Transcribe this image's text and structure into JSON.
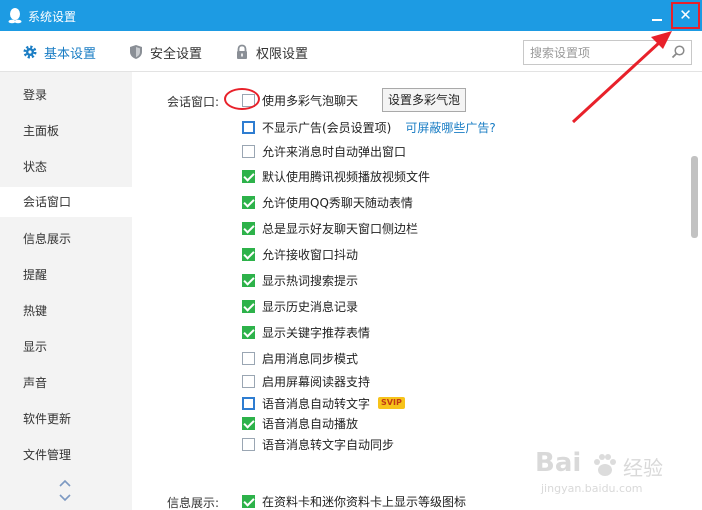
{
  "window": {
    "title": "系统设置"
  },
  "toolbar": {
    "tabs": [
      "基本设置",
      "安全设置",
      "权限设置"
    ],
    "search_placeholder": "搜索设置项"
  },
  "sidebar": {
    "items": [
      "登录",
      "主面板",
      "状态",
      "会话窗口",
      "信息展示",
      "提醒",
      "热键",
      "显示",
      "声音",
      "软件更新",
      "文件管理"
    ]
  },
  "content": {
    "section_chat": "会话窗口:",
    "options": [
      {
        "label": "使用多彩气泡聊天",
        "checked": false
      },
      {
        "label": "不显示广告(会员设置项)",
        "checked": false
      },
      {
        "label": "允许来消息时自动弹出窗口",
        "checked": false
      },
      {
        "label": "默认使用腾讯视频播放视频文件",
        "checked": true
      },
      {
        "label": "允许使用QQ秀聊天随动表情",
        "checked": true
      },
      {
        "label": "总是显示好友聊天窗口侧边栏",
        "checked": true
      },
      {
        "label": "允许接收窗口抖动",
        "checked": true
      },
      {
        "label": "显示热词搜索提示",
        "checked": true
      },
      {
        "label": "显示历史消息记录",
        "checked": true
      },
      {
        "label": "显示关键字推荐表情",
        "checked": true
      },
      {
        "label": "启用消息同步模式",
        "checked": false
      },
      {
        "label": "启用屏幕阅读器支持",
        "checked": false
      },
      {
        "label": "语音消息自动转文字",
        "checked": false
      },
      {
        "label": "语音消息自动播放",
        "checked": true
      },
      {
        "label": "语音消息转文字自动同步",
        "checked": false
      }
    ],
    "setup_bubble_button": "设置多彩气泡",
    "ad_link": "可屏蔽哪些广告?",
    "vip_badge": "SVIP",
    "section_info": "信息展示:",
    "info_option": {
      "label": "在资料卡和迷你资料卡上显示等级图标",
      "checked": true
    }
  },
  "watermark": {
    "brand": "Bai",
    "brand2": "经验",
    "sub": "jingyan.baidu.com"
  },
  "colors": {
    "titlebar": "#1d9be3",
    "accent": "#1a7dc4",
    "check": "#2db24a",
    "annotation": "#e8212a"
  }
}
